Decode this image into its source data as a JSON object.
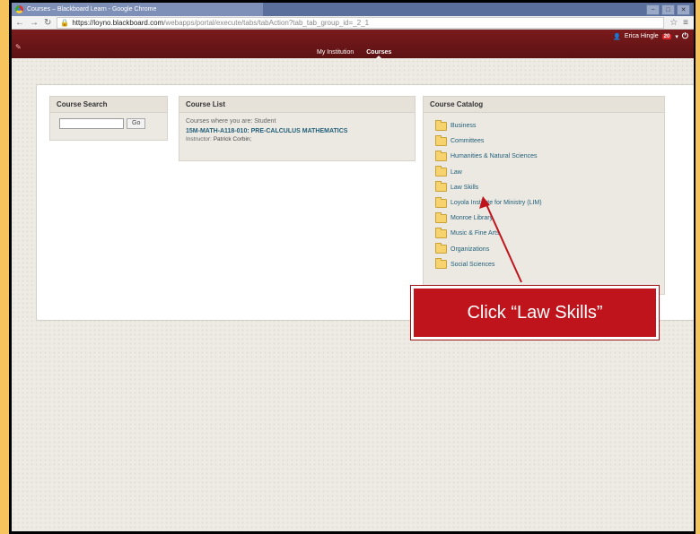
{
  "browser": {
    "tab_title": "Courses – Blackboard Learn - Google Chrome",
    "url_host": "https://loyno.blackboard.com",
    "url_path": "/webapps/portal/execute/tabs/tabAction?tab_tab_group_id=_2_1",
    "window_buttons": [
      "−",
      "□",
      "✕"
    ]
  },
  "header": {
    "user_name": "Erica Hingle",
    "notification_count": "20",
    "tabs": [
      {
        "label": "My Institution"
      },
      {
        "label": "Courses"
      }
    ]
  },
  "course_search": {
    "title": "Course Search",
    "input_value": "",
    "go_label": "Go"
  },
  "course_list": {
    "title": "Course List",
    "role_text": "Courses where you are: Student",
    "courses": [
      {
        "title": "15M-MATH-A118-010: PRE-CALCULUS MATHEMATICS",
        "instructor_label": "Instructor:",
        "instructor": "Patrick Corbin;"
      }
    ]
  },
  "course_catalog": {
    "title": "Course Catalog",
    "items": [
      "Business",
      "Committees",
      "Humanities & Natural Sciences",
      "Law",
      "Law Skills",
      "Loyola Institute for Ministry (LIM)",
      "Monroe Library",
      "Music & Fine Arts",
      "Organizations",
      "Social Sciences"
    ]
  },
  "callout": {
    "text": "Click “Law Skills”",
    "color": "#c0141c"
  },
  "colors": {
    "header": "#6b1618",
    "link": "#1f5e79",
    "frame": "#f7c35c"
  }
}
